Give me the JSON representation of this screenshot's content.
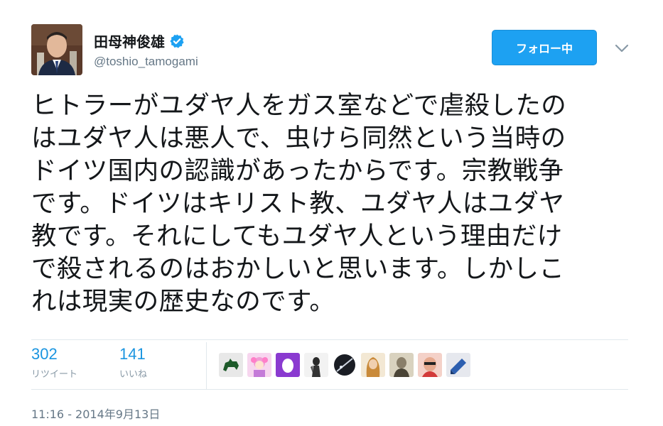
{
  "user": {
    "display_name": "田母神俊雄",
    "handle": "@toshio_tamogami",
    "verified_icon": "verified-badge-icon"
  },
  "follow_button": {
    "label": "フォロー中"
  },
  "tweet": {
    "lines": [
      "ヒトラーがユダヤ人をガス室などで虐殺したの",
      "はユダヤ人は悪人で、虫けら同然という当時の",
      "ドイツ国内の認識があったからです。宗教戦争",
      "です。ドイツはキリスト教、ユダヤ人はユダヤ",
      "教です。それにしてもユダヤ人という理由だけ",
      "で殺されるのはおかしいと思います。しかしこ",
      "れは現実の歴史なのです。"
    ]
  },
  "stats": {
    "retweets": {
      "count": "302",
      "label": "リツイート"
    },
    "likes": {
      "count": "141",
      "label": "いいね"
    }
  },
  "timestamp": "11:16 - 2014年9月13日",
  "colors": {
    "accent": "#1da1f2",
    "count_blue": "#1b95e0",
    "muted": "#657786",
    "divider": "#e1e8ed"
  }
}
